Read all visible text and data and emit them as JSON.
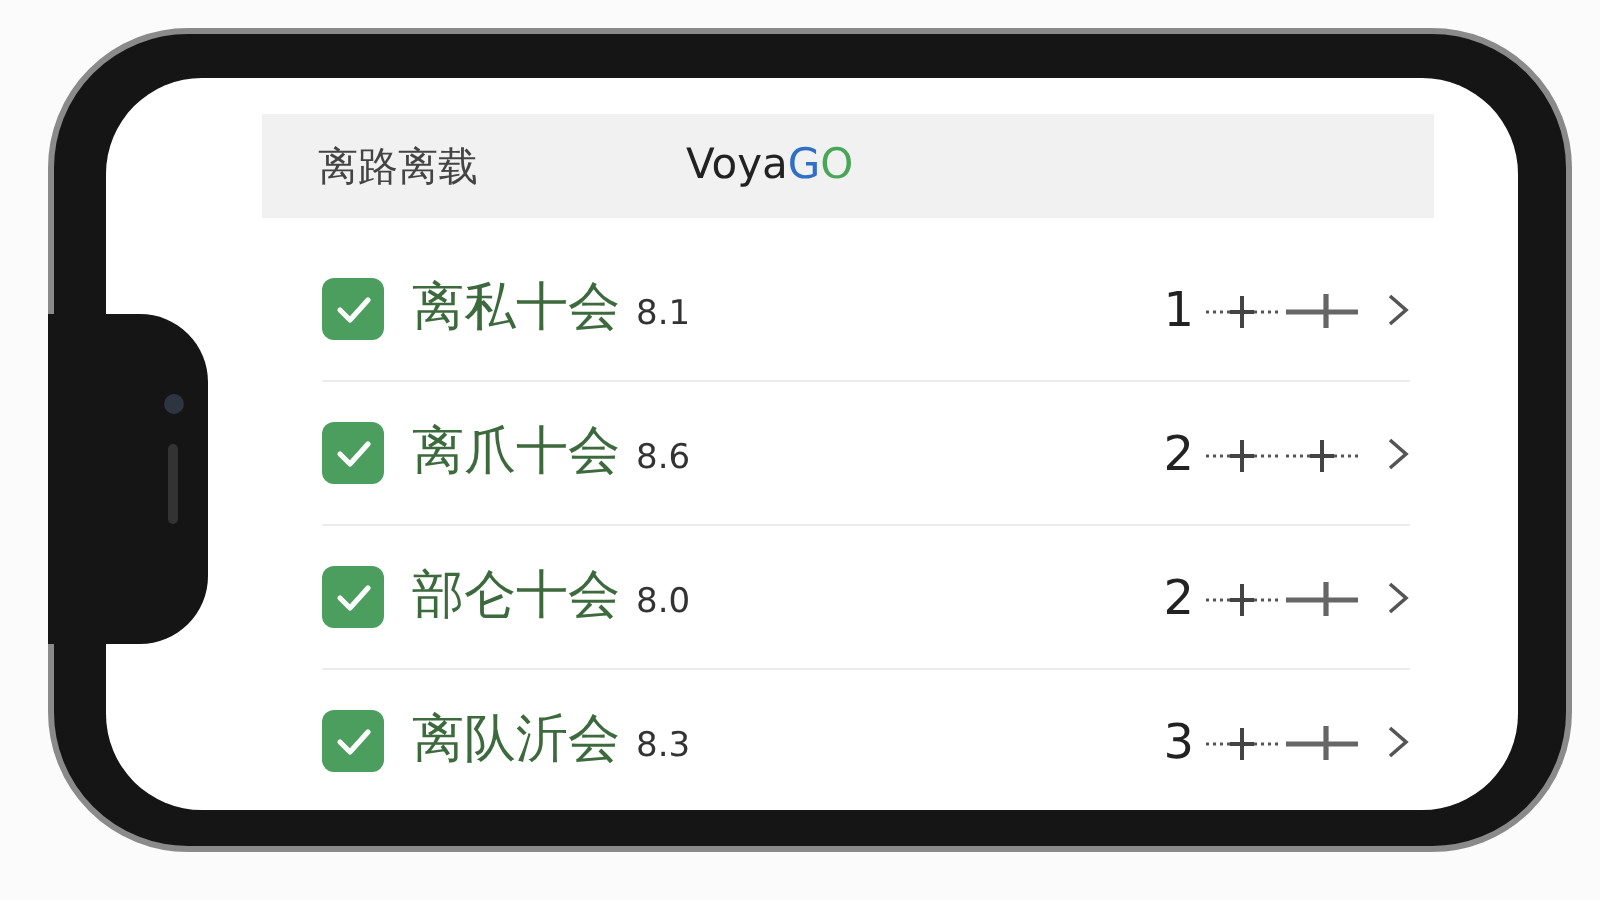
{
  "header": {
    "title": "离路离载",
    "logo": [
      {
        "text": "Voya",
        "color": "#222222"
      },
      {
        "text": "G",
        "color": "#2f6fc4"
      },
      {
        "text": "O",
        "color": "#4aa657"
      }
    ]
  },
  "rows": [
    {
      "checked": true,
      "name": "离私十会",
      "score": "8.1",
      "count": "1",
      "markers": [
        {
          "kind": "dotted"
        },
        {
          "kind": "solid"
        }
      ]
    },
    {
      "checked": true,
      "name": "离爪十会",
      "score": "8.6",
      "count": "2",
      "markers": [
        {
          "kind": "dotted"
        },
        {
          "kind": "dotted"
        }
      ]
    },
    {
      "checked": true,
      "name": "部仑十会",
      "score": "8.0",
      "count": "2",
      "markers": [
        {
          "kind": "dotted"
        },
        {
          "kind": "solid"
        }
      ]
    },
    {
      "checked": true,
      "name": "离队沂会",
      "score": "8.3",
      "count": "3",
      "markers": [
        {
          "kind": "dotted"
        },
        {
          "kind": "solid"
        }
      ]
    }
  ]
}
